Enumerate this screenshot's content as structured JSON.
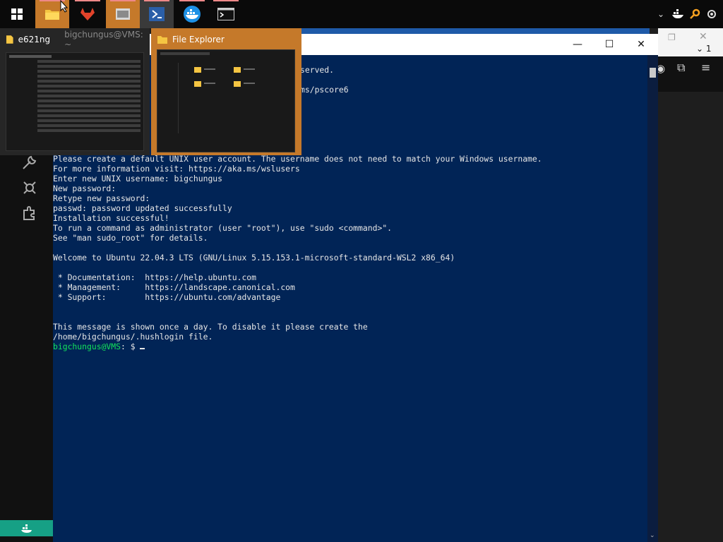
{
  "taskbar": {
    "apps": [
      {
        "name": "File Explorer"
      },
      {
        "name": "App"
      },
      {
        "name": "App"
      },
      {
        "name": "PowerShell"
      },
      {
        "name": "Docker"
      },
      {
        "name": "Terminal"
      }
    ],
    "tray": {
      "network_label": "1"
    }
  },
  "thumbnails": {
    "first": {
      "title": "e621ng",
      "tab_text": "bigchungus@VMS: ~"
    },
    "second": {
      "title": "File Explorer"
    }
  },
  "terminal": {
    "partial_line_1": "served.",
    "partial_line_2": "ms/pscore6",
    "lines": [
      "Please create a default UNIX user account. The username does not need to match your Windows username.",
      "For more information visit: https://aka.ms/wslusers",
      "Enter new UNIX username: bigchungus",
      "New password:",
      "Retype new password:",
      "passwd: password updated successfully",
      "Installation successful!",
      "To run a command as administrator (user \"root\"), use \"sudo <command>\".",
      "See \"man sudo_root\" for details.",
      "",
      "Welcome to Ubuntu 22.04.3 LTS (GNU/Linux 5.15.153.1-microsoft-standard-WSL2 x86_64)",
      "",
      " * Documentation:  https://help.ubuntu.com",
      " * Management:     https://landscape.canonical.com",
      " * Support:        https://ubuntu.com/advantage",
      "",
      "",
      "This message is shown once a day. To disable it please create the",
      "/home/bigchungus/.hushlogin file."
    ],
    "prompt": "bigchungus@VMS",
    "prompt_suffix": ": $ "
  },
  "colors": {
    "terminal_bg": "#012456",
    "prompt_green": "#13e35a",
    "taskbar_active": "#c5792a",
    "docker_green": "#16a085"
  }
}
